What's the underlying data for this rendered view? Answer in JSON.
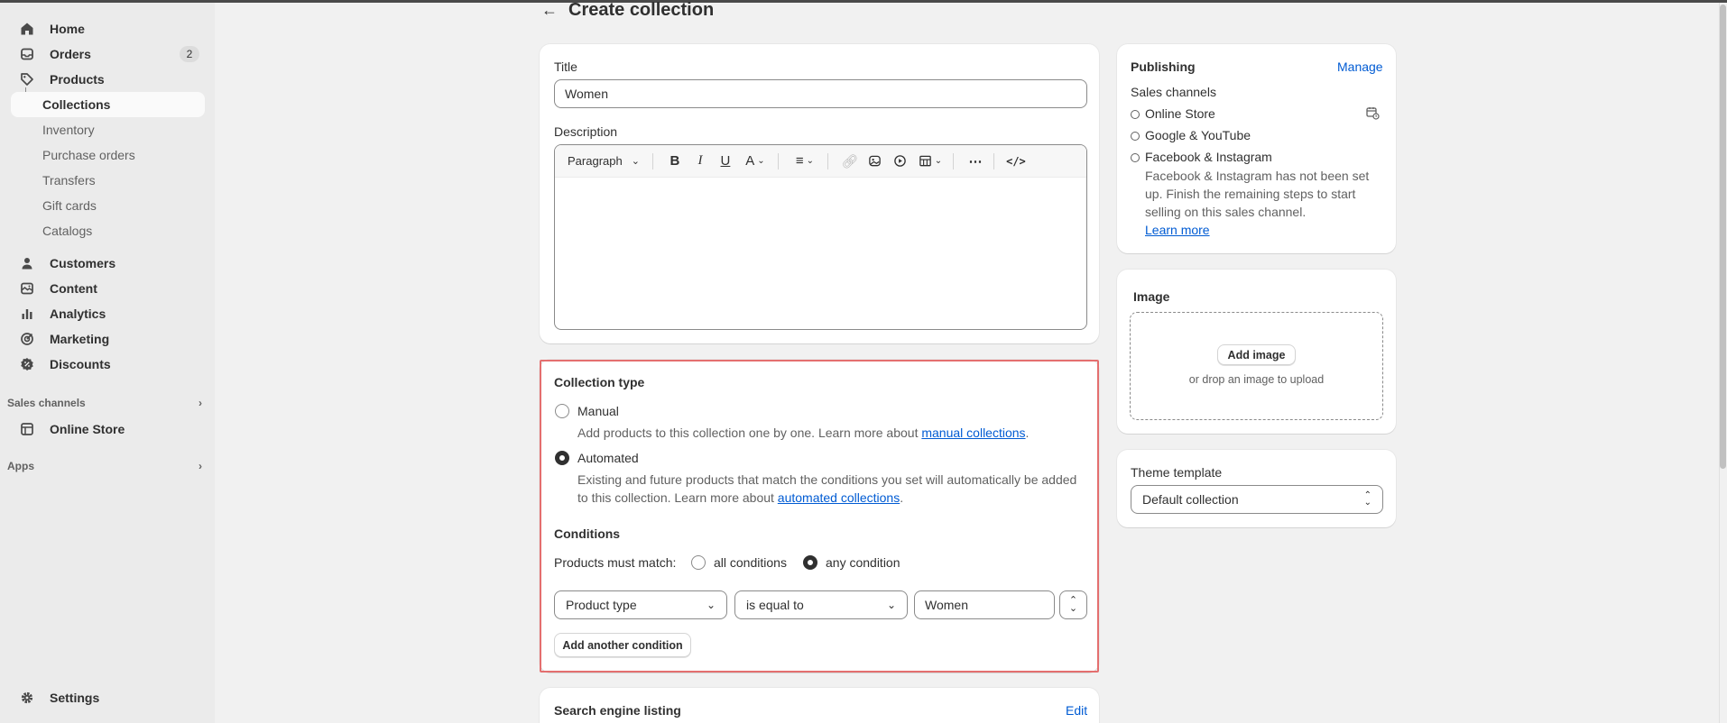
{
  "sidebar": {
    "items": [
      {
        "label": "Home",
        "icon": "home-icon"
      },
      {
        "label": "Orders",
        "icon": "inbox-icon",
        "badge": "2"
      },
      {
        "label": "Products",
        "icon": "tag-icon"
      }
    ],
    "product_sub": [
      "Collections",
      "Inventory",
      "Purchase orders",
      "Transfers",
      "Gift cards",
      "Catalogs"
    ],
    "items2": [
      {
        "label": "Customers",
        "icon": "person-icon"
      },
      {
        "label": "Content",
        "icon": "content-icon"
      },
      {
        "label": "Analytics",
        "icon": "chart-icon"
      },
      {
        "label": "Marketing",
        "icon": "target-icon"
      },
      {
        "label": "Discounts",
        "icon": "discount-icon"
      }
    ],
    "sales_channels_label": "Sales channels",
    "online_store": "Online Store",
    "apps_label": "Apps",
    "settings": "Settings"
  },
  "page": {
    "title": "Create collection"
  },
  "main": {
    "title_label": "Title",
    "title_value": "Women",
    "description_label": "Description",
    "toolbar": {
      "format": "Paragraph"
    }
  },
  "collection_type": {
    "heading": "Collection type",
    "manual_label": "Manual",
    "manual_help": "Add products to this collection one by one. Learn more about ",
    "manual_link": "manual collections",
    "automated_label": "Automated",
    "automated_help_1": "Existing and future products that match the conditions you set will automatically be added",
    "automated_help_2": "to this collection. Learn more about ",
    "automated_link": "automated collections",
    "period": ".",
    "conditions_heading": "Conditions",
    "must_match_label": "Products must match:",
    "all_conditions": "all conditions",
    "any_condition": "any condition",
    "condition": {
      "field": "Product type",
      "operator": "is equal to",
      "value": "Women"
    },
    "add_condition": "Add another condition"
  },
  "seo": {
    "heading": "Search engine listing",
    "edit": "Edit"
  },
  "publishing": {
    "heading": "Publishing",
    "manage": "Manage",
    "sales_channels": "Sales channels",
    "channels": [
      "Online Store",
      "Google & YouTube",
      "Facebook & Instagram"
    ],
    "fb_note_1": "Facebook & Instagram has not been set",
    "fb_note_2": "up. Finish the remaining steps to start",
    "fb_note_3": "selling on this sales channel.",
    "learn_more": "Learn more"
  },
  "image_card": {
    "heading": "Image",
    "add_button": "Add image",
    "drop_hint": "or drop an image to upload"
  },
  "theme": {
    "label": "Theme template",
    "value": "Default collection"
  },
  "colors": {
    "accent_link": "#005bd3",
    "highlight_border": "#e46f6f",
    "sidebar_bg": "#ebebeb",
    "page_bg": "#f1f1f1"
  }
}
